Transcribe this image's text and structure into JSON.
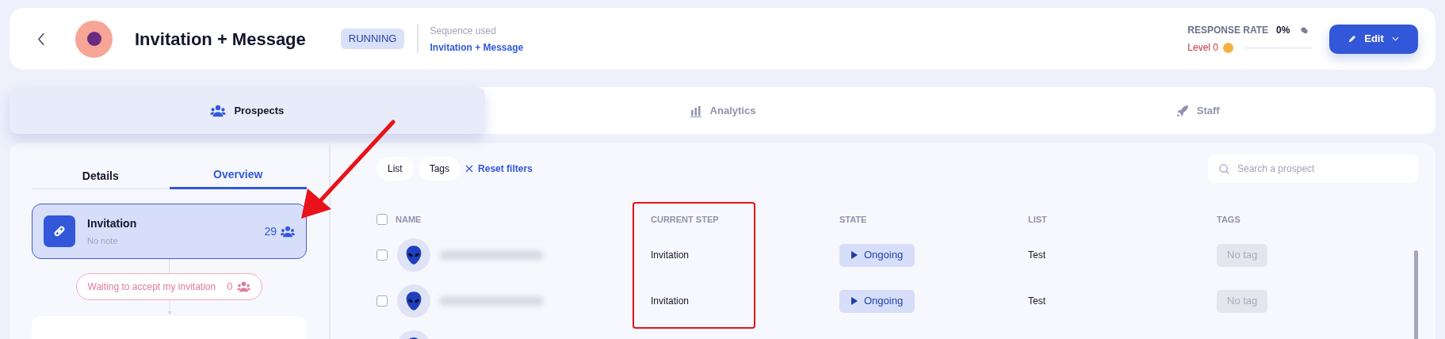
{
  "header": {
    "title": "Invitation + Message",
    "status": "RUNNING",
    "sequence_label": "Sequence used",
    "sequence_link": "Invitation + Message",
    "response_rate_label": "RESPONSE RATE",
    "response_rate_value": "0%",
    "level_text": "Level 0",
    "level": 0,
    "edit_button": "Edit"
  },
  "tabs": [
    {
      "label": "Prospects",
      "selected": true
    },
    {
      "label": "Analytics",
      "selected": false
    },
    {
      "label": "Staff",
      "selected": false
    }
  ],
  "side_tabs": [
    {
      "label": "Details",
      "selected": false
    },
    {
      "label": "Overview",
      "selected": true
    }
  ],
  "steps": [
    {
      "kind": "card",
      "title": "Invitation",
      "note": "No note",
      "count": "29",
      "selected": true
    },
    {
      "kind": "pill",
      "title": "Waiting to accept my invitation",
      "count": "0"
    },
    {
      "kind": "card_partial"
    }
  ],
  "filters": [
    {
      "label": "List"
    },
    {
      "label": "Tags"
    }
  ],
  "reset_filters": "Reset filters",
  "search": {
    "placeholder": "Search a prospect"
  },
  "table": {
    "select_all_checked": false,
    "columns": [
      "NAME",
      "CURRENT STEP",
      "STATE",
      "LIST",
      "TAGS"
    ],
    "rows": [
      {
        "checked": false,
        "current_step": "Invitation",
        "state": "Ongoing",
        "list": "Test",
        "tags": "No tag"
      },
      {
        "checked": false,
        "current_step": "Invitation",
        "state": "Ongoing",
        "list": "Test",
        "tags": "No tag"
      },
      {}
    ]
  }
}
